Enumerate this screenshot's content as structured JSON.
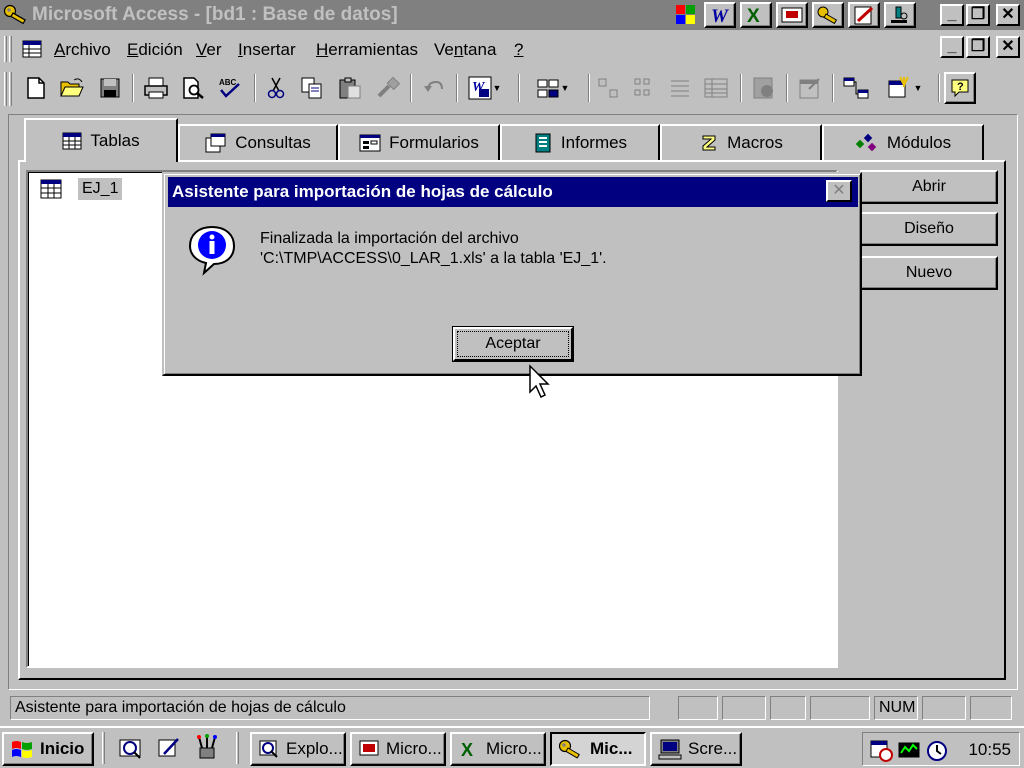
{
  "window": {
    "title": "Microsoft Access - [bd1 : Base de datos]",
    "minimize": "_",
    "restore": "❐",
    "close": "✕"
  },
  "menu": {
    "items": [
      {
        "label": "Archivo",
        "accel": "A"
      },
      {
        "label": "Edición",
        "accel": "E"
      },
      {
        "label": "Ver",
        "accel": "V"
      },
      {
        "label": "Insertar",
        "accel": "I"
      },
      {
        "label": "Herramientas",
        "accel": "H"
      },
      {
        "label": "Ventana",
        "accel": "n"
      },
      {
        "label": "?",
        "accel": "?"
      }
    ]
  },
  "tabs": [
    {
      "label": "Tablas",
      "icon": "table-icon",
      "active": true
    },
    {
      "label": "Consultas",
      "icon": "query-icon",
      "active": false
    },
    {
      "label": "Formularios",
      "icon": "form-icon",
      "active": false
    },
    {
      "label": "Informes",
      "icon": "report-icon",
      "active": false
    },
    {
      "label": "Macros",
      "icon": "macro-icon",
      "active": false
    },
    {
      "label": "Módulos",
      "icon": "module-icon",
      "active": false
    }
  ],
  "object_list": [
    {
      "name": "EJ_1",
      "icon": "table-icon",
      "selected": true
    }
  ],
  "side_buttons": {
    "open": "Abrir",
    "design": "Diseño",
    "new": "Nuevo"
  },
  "dialog": {
    "title": "Asistente para importación de hojas de cálculo",
    "line1": "Finalizada la importación del archivo",
    "line2": "'C:\\TMP\\ACCESS\\0_LAR_1.xls' a la tabla 'EJ_1'.",
    "ok_label": "Aceptar",
    "icon": "info-icon"
  },
  "status": {
    "text": "Asistente para importación de hojas de cálculo",
    "num": "NUM"
  },
  "taskbar": {
    "start_label": "Inicio",
    "tasks": [
      {
        "label": "Explo...",
        "icon": "explorer-icon",
        "active": false
      },
      {
        "label": "Micro...",
        "icon": "powerpoint-icon",
        "active": false
      },
      {
        "label": "Micro...",
        "icon": "excel-icon",
        "active": false
      },
      {
        "label": "Mic...",
        "icon": "access-key-icon",
        "active": true
      },
      {
        "label": "Scre...",
        "icon": "screen-icon",
        "active": false
      }
    ],
    "clock": "10:55"
  },
  "colors": {
    "face": "#c0c0c0",
    "dialog_title": "#000080",
    "inactive_title": "#808080"
  }
}
